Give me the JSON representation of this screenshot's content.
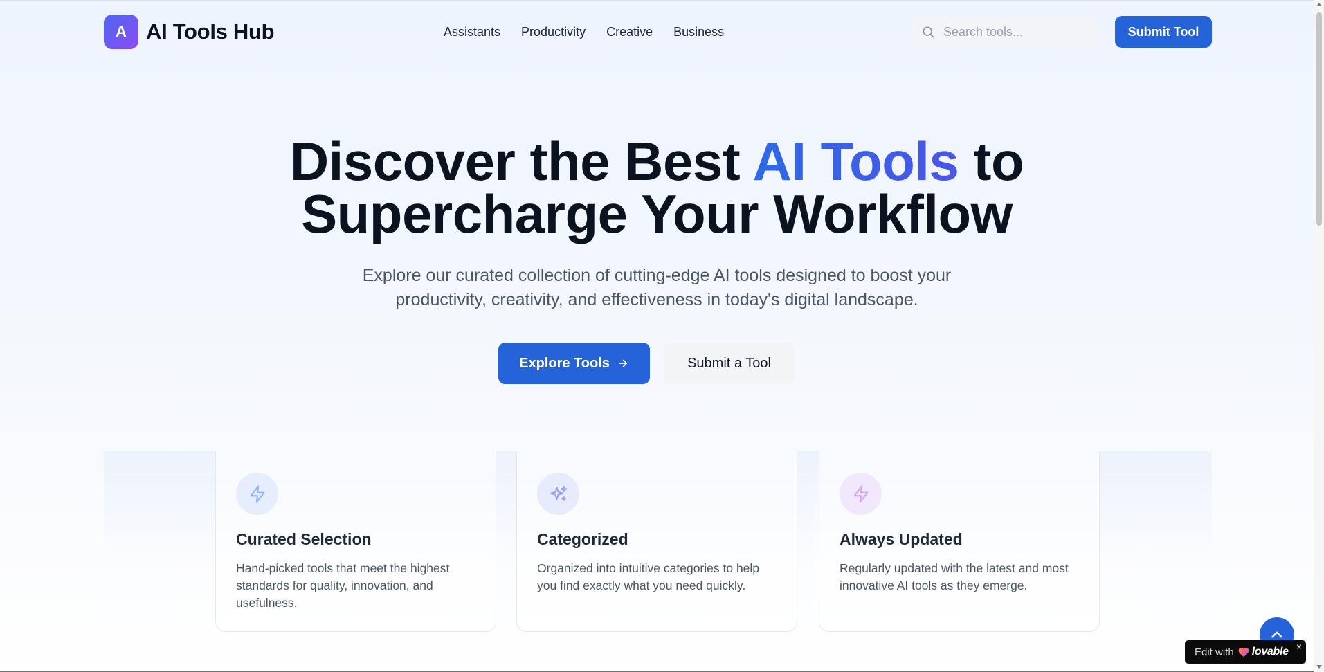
{
  "header": {
    "logo_letter": "A",
    "logo_text": "AI Tools Hub",
    "nav": [
      "Assistants",
      "Productivity",
      "Creative",
      "Business"
    ],
    "search_placeholder": "Search tools...",
    "submit_label": "Submit Tool"
  },
  "hero": {
    "title_part1": "Discover the Best ",
    "title_accent": "AI Tools",
    "title_part2": " to",
    "title_line2": "Supercharge Your Workflow",
    "subtitle": "Explore our curated collection of cutting-edge AI tools designed to boost your productivity, creativity, and effectiveness in today's digital landscape.",
    "primary_cta": "Explore Tools",
    "secondary_cta": "Submit a Tool"
  },
  "features": [
    {
      "title": "Curated Selection",
      "description": "Hand-picked tools that meet the highest standards for quality, innovation, and usefulness.",
      "icon": "lightning-icon",
      "color": "#3b82f6"
    },
    {
      "title": "Categorized",
      "description": "Organized into intuitive categories to help you find exactly what you need quickly.",
      "icon": "sparkles-icon",
      "color": "#5b6ee8"
    },
    {
      "title": "Always Updated",
      "description": "Regularly updated with the latest and most innovative AI tools as they emerge.",
      "icon": "lightning-icon",
      "color": "#a855f7"
    }
  ],
  "badge": {
    "prefix": "Edit with",
    "brand": "lovable",
    "close": "×"
  },
  "colors": {
    "primary": "#2563d9",
    "accent_gradient_start": "#2d6ae6",
    "accent_gradient_end": "#4b55e6",
    "logo_gradient_start": "#4f67f0",
    "logo_gradient_end": "#8b4cf0"
  }
}
